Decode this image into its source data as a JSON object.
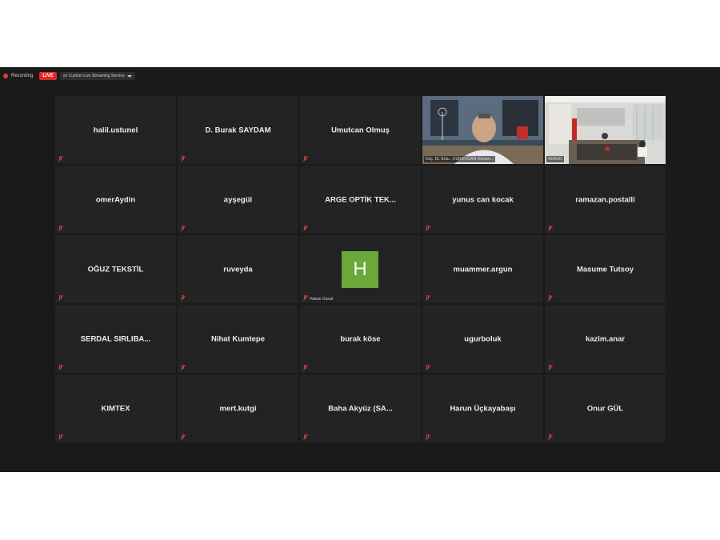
{
  "topbar": {
    "recording_label": "Recording",
    "live_label": "LIVE",
    "stream_label": "on Custom Live Streaming Service"
  },
  "video_tiles": [
    {
      "label": "Doç. Dr. Erta... KURDOĞAN Osman..."
    },
    {
      "label": "ADASO"
    }
  ],
  "participants": [
    {
      "name": "halil.ustunel"
    },
    {
      "name": "D. Burak SAYDAM"
    },
    {
      "name": "Umutcan Olmuş"
    },
    {
      "name": "omerAydin"
    },
    {
      "name": "ayşegül"
    },
    {
      "name": "ARGE OPTİK TEK..."
    },
    {
      "name": "yunus can kocak"
    },
    {
      "name": "ramazan.postalli"
    },
    {
      "name": "OĞUZ TEKSTİL"
    },
    {
      "name": "ruveyda"
    },
    {
      "name": "Hakan Günal",
      "avatar_letter": "H"
    },
    {
      "name": "muammer.argun"
    },
    {
      "name": "Masume Tutsoy"
    },
    {
      "name": "SERDAL SIRLIBA..."
    },
    {
      "name": "Nihat Kumtepe"
    },
    {
      "name": "burak köse"
    },
    {
      "name": "ugurboluk"
    },
    {
      "name": "kazim.anar"
    },
    {
      "name": "KIMTEX"
    },
    {
      "name": "mert.kutgi"
    },
    {
      "name": "Baha Akyüz (SA..."
    },
    {
      "name": "Harun Üçkayabaşı"
    },
    {
      "name": "Onur GÜL"
    }
  ],
  "colors": {
    "background": "#1a1a1a",
    "tile": "#232323",
    "live": "#e02828",
    "active_speaker": "#c4e04a",
    "avatar": "#6aa83a",
    "muted": "#d8403a"
  }
}
